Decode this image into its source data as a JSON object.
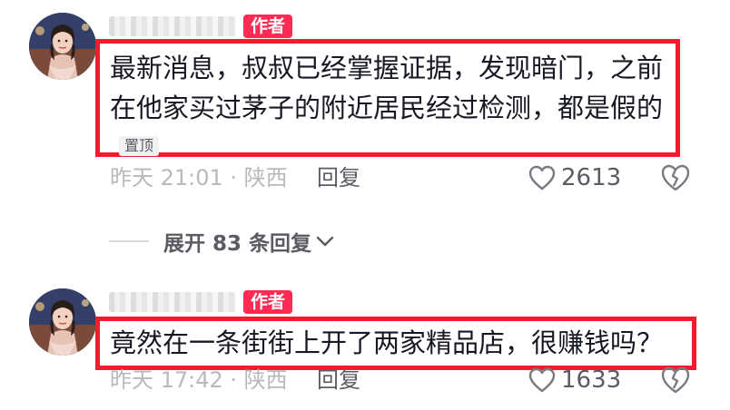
{
  "comments": [
    {
      "author_badge": "作者",
      "text": "最新消息，叔叔已经掌握证据，发现暗门，之前在他家买过茅子的附近居民经过检测，都是假的",
      "pin_tag": "置顶",
      "meta": "昨天 21:01 · 陕西",
      "reply_label": "回复",
      "likes": "2613"
    },
    {
      "author_badge": "作者",
      "text": "竟然在一条街街上开了两家精品店，很赚钱吗？",
      "meta": "昨天 17:42 · 陕西",
      "reply_label": "回复",
      "likes": "1633"
    }
  ],
  "expand_replies": "展开 83 条回复",
  "icons": {
    "like": "heart-outline-icon",
    "dislike": "broken-heart-icon",
    "expand": "chevron-down-icon"
  },
  "colors": {
    "highlight_border": "#f41b2c",
    "author_badge": "#fe2c55",
    "meta_text": "#b9b9bd"
  }
}
